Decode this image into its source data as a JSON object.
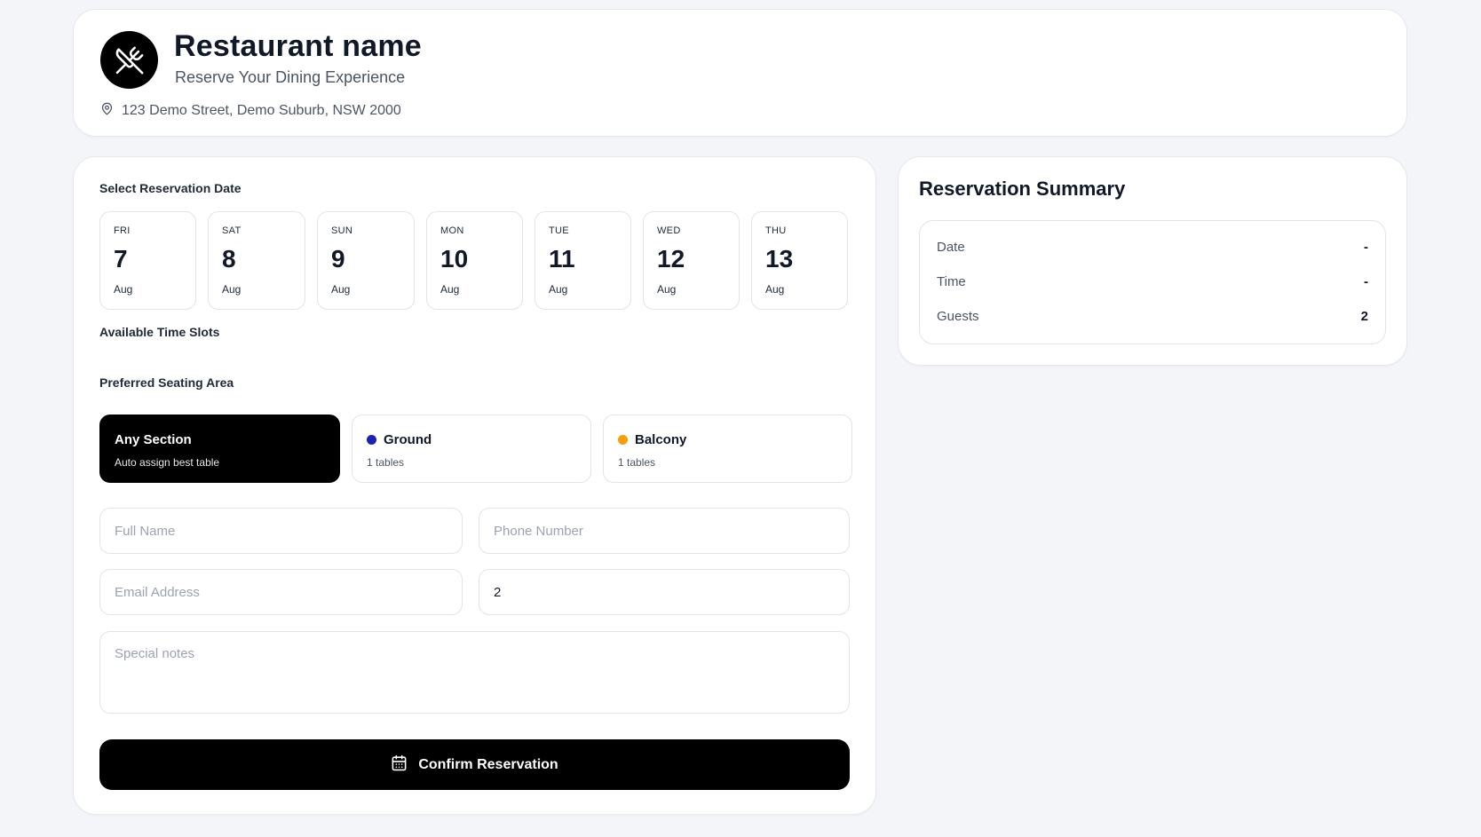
{
  "header": {
    "logo_icon": "utensils-crossed-icon",
    "title": "Restaurant name",
    "subtitle": "Reserve Your Dining Experience",
    "address_icon": "map-pin-icon",
    "address": "123 Demo Street, Demo Suburb, NSW 2000"
  },
  "form": {
    "date_label": "Select Reservation Date",
    "dates": [
      {
        "dow": "FRI",
        "day": "7",
        "month": "Aug"
      },
      {
        "dow": "SAT",
        "day": "8",
        "month": "Aug"
      },
      {
        "dow": "SUN",
        "day": "9",
        "month": "Aug"
      },
      {
        "dow": "MON",
        "day": "10",
        "month": "Aug"
      },
      {
        "dow": "TUE",
        "day": "11",
        "month": "Aug"
      },
      {
        "dow": "WED",
        "day": "12",
        "month": "Aug"
      },
      {
        "dow": "THU",
        "day": "13",
        "month": "Aug"
      }
    ],
    "time_label": "Available Time Slots",
    "seating_label": "Preferred Seating Area",
    "seating": [
      {
        "name": "Any Section",
        "sub": "Auto assign best table",
        "selected": true
      },
      {
        "name": "Ground",
        "sub": "1 tables",
        "color": "#1e22b4"
      },
      {
        "name": "Balcony",
        "sub": "1 tables",
        "color": "#f59e0b"
      }
    ],
    "full_name_placeholder": "Full Name",
    "phone_placeholder": "Phone Number",
    "email_placeholder": "Email Address",
    "guests_value": "2",
    "notes_placeholder": "Special notes",
    "confirm_icon": "calendar-icon",
    "confirm_label": "Confirm Reservation"
  },
  "summary": {
    "title": "Reservation Summary",
    "rows": [
      {
        "label": "Date",
        "value": "-"
      },
      {
        "label": "Time",
        "value": "-"
      },
      {
        "label": "Guests",
        "value": "2"
      }
    ]
  },
  "colors": {
    "background": "#f3f5f8",
    "primary": "#000000",
    "ground_dot": "#1e22b4",
    "balcony_dot": "#f59e0b"
  }
}
